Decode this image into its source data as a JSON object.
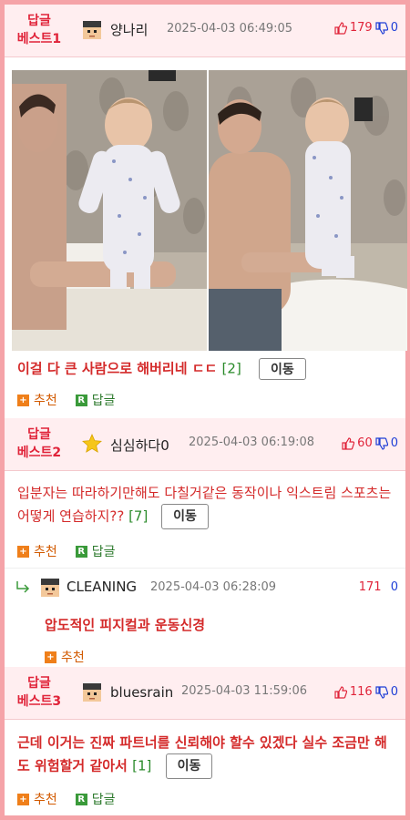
{
  "c1": {
    "badge1": "답글",
    "badge2": "베스트1",
    "nick": "양나리",
    "date": "2025-04-03 06:49:05",
    "up": "179",
    "down": "0",
    "title": "이걸 다 큰 사람으로 해버리네 ㄷㄷ",
    "count": "[2]",
    "move": "이동",
    "recommend": "추천",
    "reply": "답글"
  },
  "c2": {
    "badge1": "답글",
    "badge2": "베스트2",
    "nick": "심심하다0",
    "date": "2025-04-03 06:19:08",
    "up": "60",
    "down": "0",
    "text": "입분자는 따라하기만해도 다칠거같은 동작이나 익스트림 스포츠는 어떻게 연습하지??",
    "count": "[7]",
    "move": "이동",
    "recommend": "추천",
    "reply": "답글"
  },
  "r1": {
    "nick": "CLEANING",
    "date": "2025-04-03 06:28:09",
    "up": "171",
    "down": "0",
    "text": "압도적인 피지컬과 운동신경",
    "recommend": "추천"
  },
  "c3": {
    "badge1": "답글",
    "badge2": "베스트3",
    "nick": "bluesrain",
    "date": "2025-04-03 11:59:06",
    "up": "116",
    "down": "0",
    "text": "근데 이거는 진짜 파트너를 신뢰해야 할수 있겠다 실수 조금만 해도 위험할거 같아서",
    "count": "[1]",
    "move": "이동",
    "recommend": "추천",
    "reply": "답글"
  }
}
